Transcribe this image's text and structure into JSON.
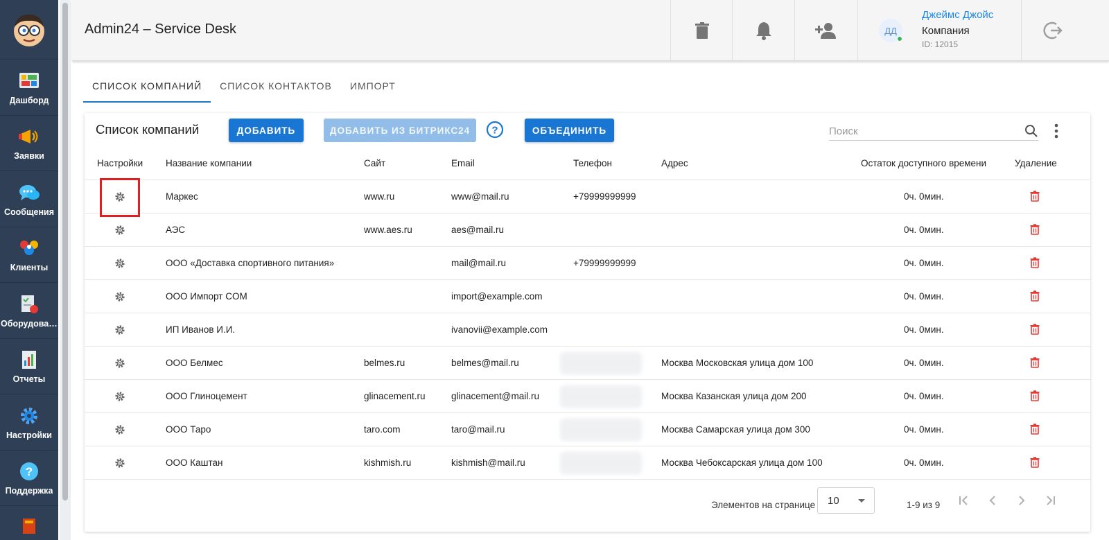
{
  "app": {
    "title": "Admin24 – Service Desk"
  },
  "sidebar": {
    "items": [
      {
        "label": "Дашборд",
        "icon": "dashboard-icon"
      },
      {
        "label": "Заявки",
        "icon": "megaphone-icon"
      },
      {
        "label": "Сообщения",
        "icon": "chat-icon"
      },
      {
        "label": "Клиенты",
        "icon": "clients-icon"
      },
      {
        "label": "Оборудован...",
        "icon": "equipment-icon"
      },
      {
        "label": "Отчеты",
        "icon": "reports-icon"
      },
      {
        "label": "Настройки",
        "icon": "gear-icon"
      },
      {
        "label": "Поддержка",
        "icon": "help-icon"
      }
    ]
  },
  "header": {
    "user": {
      "initials": "ДД",
      "name": "Джеймс Джойс",
      "role": "Компания",
      "id": "ID: 12015"
    }
  },
  "tabs": [
    "СПИСОК КОМПАНИЙ",
    "СПИСОК КОНТАКТОВ",
    "ИМПОРТ"
  ],
  "card": {
    "title": "Список компаний",
    "add_label": "ДОБАВИТЬ",
    "add_bitrix_label": "ДОБАВИТЬ ИЗ БИТРИКС24",
    "merge_label": "ОБЪЕДИНИТЬ",
    "search_placeholder": "Поиск"
  },
  "table": {
    "headers": {
      "settings": "Настройки",
      "name": "Название компании",
      "site": "Сайт",
      "email": "Email",
      "phone": "Телефон",
      "address": "Адрес",
      "time_left": "Остаток доступного времени",
      "delete": "Удаление"
    },
    "rows": [
      {
        "name": "Маркес",
        "site": "www.ru",
        "email": "www@mail.ru",
        "phone": "+79999999999",
        "address": "",
        "time_left": "0ч. 0мин."
      },
      {
        "name": "АЭС",
        "site": "www.aes.ru",
        "email": "aes@mail.ru",
        "phone": "",
        "address": "",
        "time_left": "0ч. 0мин."
      },
      {
        "name": "ООО «Доставка спортивного питания»",
        "site": "",
        "email": "mail@mail.ru",
        "phone": "+79999999999",
        "address": "",
        "time_left": "0ч. 0мин."
      },
      {
        "name": "ООО Импорт COM",
        "site": "",
        "email": "import@example.com",
        "phone": "",
        "address": "",
        "time_left": "0ч. 0мин."
      },
      {
        "name": "ИП Иванов И.И.",
        "site": "",
        "email": "ivanovii@example.com",
        "phone": "",
        "address": "",
        "time_left": "0ч. 0мин."
      },
      {
        "name": "ООО Белмес",
        "site": "belmes.ru",
        "email": "belmes@mail.ru",
        "phone": "",
        "address": "Москва Московская улица дом 100",
        "time_left": "0ч. 0мин."
      },
      {
        "name": "ООО Глиноцемент",
        "site": "glinacement.ru",
        "email": "glinacement@mail.ru",
        "phone": "",
        "address": "Москва Казанская улица дом 200",
        "time_left": "0ч. 0мин."
      },
      {
        "name": "ООО Таро",
        "site": "taro.com",
        "email": "taro@mail.ru",
        "phone": "",
        "address": "Москва Самарская улица дом 300",
        "time_left": "0ч. 0мин."
      },
      {
        "name": "ООО Каштан",
        "site": "kishmish.ru",
        "email": "kishmish@mail.ru",
        "phone": "",
        "address": "Москва Чебоксарская улица дом 100",
        "time_left": "0ч. 0мин."
      }
    ]
  },
  "pagination": {
    "per_page_label": "Элементов на странице",
    "per_page_value": "10",
    "range": "1-9 из 9"
  },
  "colors": {
    "sidebar": "#2f3f55",
    "primary": "#1976d2",
    "delete": "#e53935",
    "highlight": "#e02020"
  }
}
